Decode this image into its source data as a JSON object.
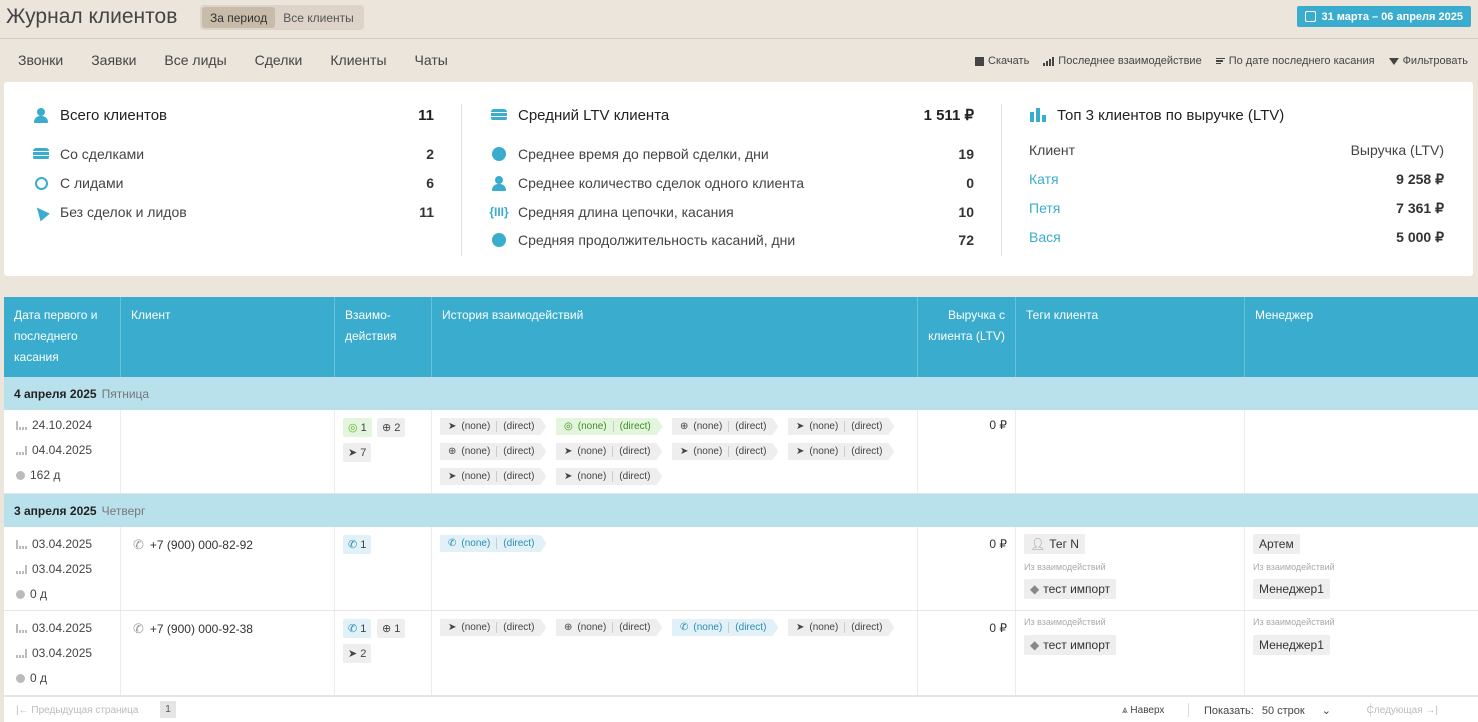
{
  "header": {
    "title": "Журнал клиентов",
    "seg_period": "За период",
    "seg_all": "Все клиенты",
    "date_range": "31 марта – 06 апреля 2025"
  },
  "nav": [
    "Звонки",
    "Заявки",
    "Все лиды",
    "Сделки",
    "Клиенты",
    "Чаты"
  ],
  "actions": {
    "download": "Скачать",
    "last_interaction": "Последнее взаимодействие",
    "by_last_touch": "По дате последнего касания",
    "filter": "Фильтровать"
  },
  "summary": {
    "clients": {
      "title": "Всего клиентов",
      "total": "11",
      "with_deals_label": "Со сделками",
      "with_deals": "2",
      "with_leads_label": "С лидами",
      "with_leads": "6",
      "no_deals_label": "Без сделок и лидов",
      "no_deals": "11"
    },
    "ltv": {
      "title": "Средний LTV клиента",
      "value": "1 511 ₽",
      "avg_time_label": "Среднее время до первой сделки, дни",
      "avg_time": "19",
      "avg_deals_label": "Среднее количество сделок одного клиента",
      "avg_deals": "0",
      "avg_chain_label": "Средняя длина цепочки, касания",
      "avg_chain": "10",
      "avg_duration_label": "Средняя продолжительность касаний, дни",
      "avg_duration": "72"
    },
    "top": {
      "title": "Топ 3 клиентов по выручке (LTV)",
      "col_client": "Клиент",
      "col_revenue": "Выручка (LTV)",
      "rows": [
        {
          "name": "Катя",
          "value": "9 258 ₽"
        },
        {
          "name": "Петя",
          "value": "7 361 ₽"
        },
        {
          "name": "Вася",
          "value": "5 000 ₽"
        }
      ]
    }
  },
  "table": {
    "headers": [
      "Дата первого и последнего касания",
      "Клиент",
      "Взаимо-действия",
      "История взаимодействий",
      "Выручка с клиента (LTV)",
      "Теги клиента",
      "Менеджер"
    ],
    "groups": [
      {
        "date": "4 апреля 2025",
        "weekday": "Пятница"
      },
      {
        "date": "3 апреля 2025",
        "weekday": "Четверг"
      }
    ],
    "rows": [
      {
        "first": "24.10.2024",
        "last": "04.04.2025",
        "duration": "162 д",
        "client": "",
        "counts": {
          "chat": "1",
          "lead": "2",
          "send": "7"
        },
        "revenue": "0 ₽"
      },
      {
        "first": "03.04.2025",
        "last": "03.04.2025",
        "duration": "0 д",
        "client": "+7 (900) 000-82-92",
        "counts": {
          "call": "1"
        },
        "revenue": "0 ₽",
        "tag1": "Тег N",
        "tag_note": "Из взаимодействий",
        "tag2": "тест импорт",
        "manager1": "Артем",
        "manager_note": "Из взаимодействий",
        "manager2": "Менеджер1"
      },
      {
        "first": "03.04.2025",
        "last": "03.04.2025",
        "duration": "0 д",
        "client": "+7 (900) 000-92-38",
        "counts": {
          "call": "1",
          "lead": "1",
          "send": "2"
        },
        "revenue": "0 ₽",
        "tag_note": "Из взаимодействий",
        "tag2": "тест импорт",
        "manager_note": "Из взаимодействий",
        "manager2": "Менеджер1"
      }
    ],
    "pill_source": "(none)",
    "pill_medium": "(direct)"
  },
  "footer": {
    "prev": "Предыдущая страница",
    "page": "1",
    "up": "Наверх",
    "show_label": "Показать:",
    "show_value": "50 строк",
    "next": "Следующая"
  },
  "colors": {
    "accent": "#3aaccd",
    "group_bg": "#b9e1ec",
    "page_bg": "#ece5dc"
  }
}
